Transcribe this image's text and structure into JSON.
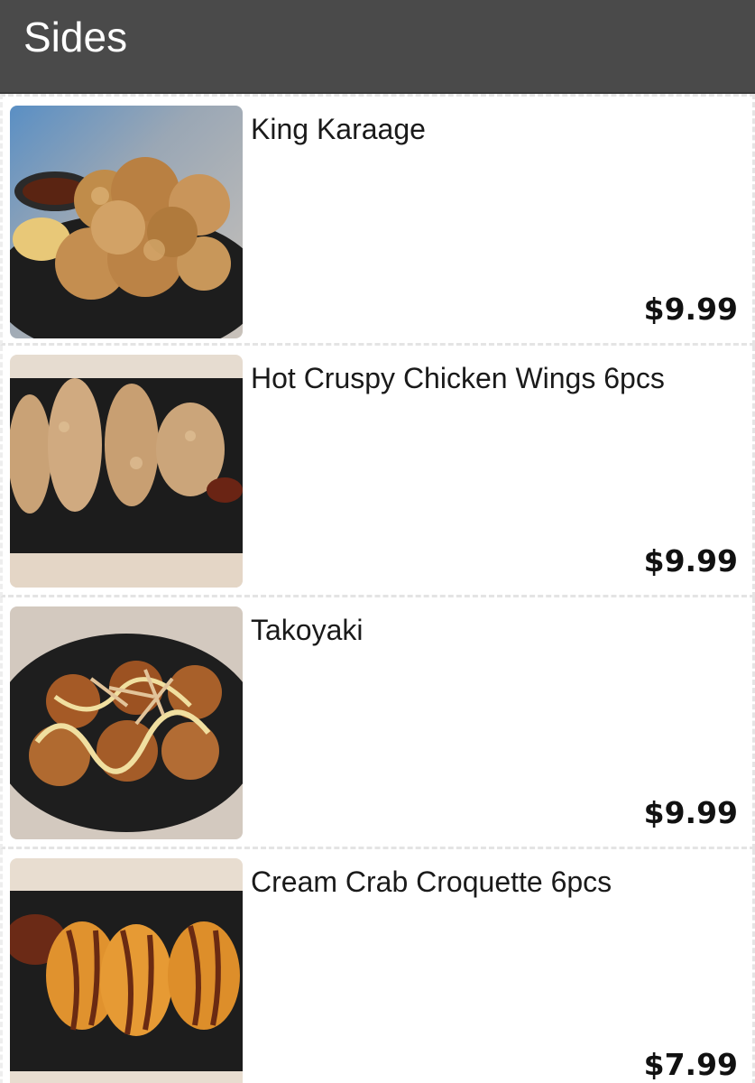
{
  "header": {
    "title": "Sides",
    "background_color": "#4a4a4a"
  },
  "items": [
    {
      "name": "King Karaage",
      "price": "$9.99",
      "image": "fried-chicken-karaage-image"
    },
    {
      "name": "Hot Cruspy Chicken Wings 6pcs",
      "price": "$9.99",
      "image": "chicken-wings-image"
    },
    {
      "name": "Takoyaki",
      "price": "$9.99",
      "image": "takoyaki-image"
    },
    {
      "name": "Cream Crab Croquette 6pcs",
      "price": "$7.99",
      "image": "crab-croquette-image"
    }
  ]
}
